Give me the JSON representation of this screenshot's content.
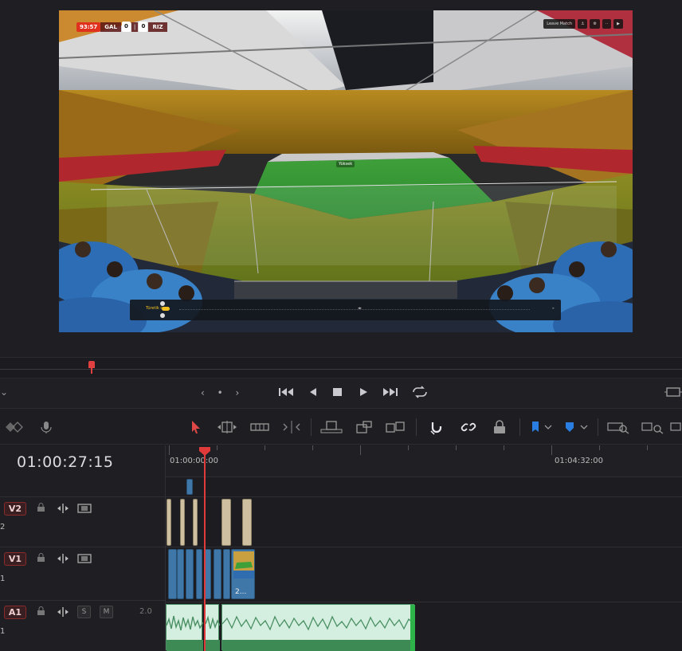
{
  "viewer": {
    "scorebug": {
      "time": "93:57",
      "home": "GAL",
      "home_score": "0",
      "away_score": "0",
      "away": "RIZ"
    },
    "overlay_buttons": [
      "Leave Match",
      "⚓",
      "⚙",
      "··",
      "▶"
    ],
    "center_label": "Yüksek",
    "bottom_bar": {
      "text": "Türetik oc",
      "mid": "◂▸",
      "end": "▸"
    }
  },
  "transport": {
    "nav": "‹ • ›",
    "buttons": [
      "first-frame",
      "prev-frame",
      "stop",
      "play",
      "last-frame",
      "loop"
    ]
  },
  "timeline": {
    "timecode": "01:00:27:15",
    "ruler": [
      {
        "label": "01:00:00:00"
      },
      {
        "label": "01:04:32:00"
      }
    ],
    "tracks": [
      {
        "id": "V2",
        "num": "2"
      },
      {
        "id": "V1",
        "num": "1"
      },
      {
        "id": "A1",
        "num": "1",
        "solo": "S",
        "mute": "M",
        "volume": "2.0"
      }
    ],
    "v1_thumb_clip_label": "2..."
  },
  "colors": {
    "accent": "#e03a3a",
    "clip_blue": "#3f78a8",
    "clip_beige": "#cdbfa0",
    "audio_green": "#4a8f63",
    "marker_blue": "#2a7de1"
  }
}
